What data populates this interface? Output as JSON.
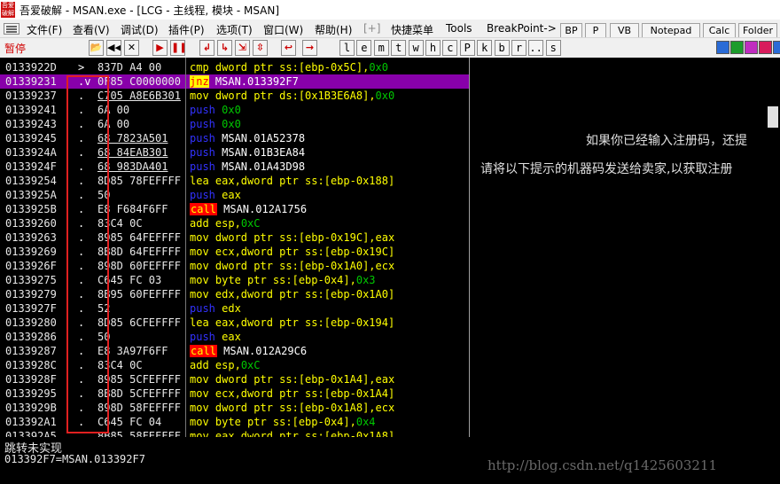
{
  "window": {
    "title": "吾爱破解 - MSAN.exe - [LCG - 主线程, 模块 - MSAN]",
    "app_icon_text": "吾爱破解"
  },
  "menubar": {
    "items": [
      "文件(F)",
      "查看(V)",
      "调试(D)",
      "插件(P)",
      "选项(T)",
      "窗口(W)",
      "帮助(H)",
      "[+]",
      "快捷菜单",
      "Tools",
      "BreakPoint->"
    ]
  },
  "right_panel_buttons": [
    "BP",
    "P",
    "VB",
    "Notepad",
    "Calc",
    "Folder"
  ],
  "toolbar": {
    "status": "暂停",
    "nav_buttons": [
      {
        "name": "open-file-button",
        "glyph": "📂",
        "red": false
      },
      {
        "name": "restart-button",
        "glyph": "◀◀",
        "red": false
      },
      {
        "name": "close-process-button",
        "glyph": "✕",
        "red": false
      },
      {
        "name": "run-button",
        "glyph": "▶",
        "red": true
      },
      {
        "name": "pause-button",
        "glyph": "❚❚",
        "red": true
      },
      {
        "name": "step-into-button",
        "glyph": "↲",
        "red": true
      },
      {
        "name": "step-over-button",
        "glyph": "↳",
        "red": true
      },
      {
        "name": "trace-into-button",
        "glyph": "⇲",
        "red": true
      },
      {
        "name": "trace-over-button",
        "glyph": "⇳",
        "red": true
      },
      {
        "name": "execute-till-return-button",
        "glyph": "↩",
        "red": true
      },
      {
        "name": "go-to-address-button",
        "glyph": "→",
        "red": true
      }
    ],
    "window_letters": [
      "l",
      "e",
      "m",
      "t",
      "w",
      "h",
      "c",
      "P",
      "k",
      "b",
      "r",
      "...",
      "s"
    ],
    "right_icons": [
      {
        "name": "refresh-icon",
        "color": "#2a6bd6"
      },
      {
        "name": "grid-green-icon",
        "color": "#1c9c2c"
      },
      {
        "name": "sparkle-icon",
        "color": "#c02cc0"
      },
      {
        "name": "about-a-icon",
        "color": "#d81c5c"
      },
      {
        "name": "options-grid-icon",
        "color": "#2a6bd6"
      }
    ]
  },
  "disassembly": {
    "rows": [
      {
        "addr": "0133922D",
        "mark": ">",
        "hex": "837D A4 00",
        "hex_ul": false,
        "selected": false,
        "asm": [
          {
            "t": "cmp",
            "k": "mn"
          },
          {
            "t": " dword ptr ss:[ebp-0x5C]",
            "k": "op y"
          },
          {
            "t": ",",
            "k": "op y"
          },
          {
            "t": "0x0",
            "k": "op imm"
          }
        ]
      },
      {
        "addr": "01339231",
        "mark": ".v",
        "hex": "0F85 C0000000",
        "hex_ul": false,
        "selected": true,
        "asm": [
          {
            "t": "jnz",
            "k": "mn jnz"
          },
          {
            "t": " MSAN.013392F7",
            "k": "op"
          }
        ]
      },
      {
        "addr": "01339237",
        "mark": ".",
        "hex": "C705 A8E6B301",
        "hex_ul": true,
        "selected": false,
        "asm": [
          {
            "t": "mov",
            "k": "mn"
          },
          {
            "t": " dword ptr ds:[0x1B3E6A8]",
            "k": "op y"
          },
          {
            "t": ",",
            "k": "op y"
          },
          {
            "t": "0x0",
            "k": "op imm"
          }
        ]
      },
      {
        "addr": "01339241",
        "mark": ".",
        "hex": "6A 00",
        "hex_ul": false,
        "selected": false,
        "asm": [
          {
            "t": "push",
            "k": "mn push"
          },
          {
            "t": " 0x0",
            "k": "op imm"
          }
        ]
      },
      {
        "addr": "01339243",
        "mark": ".",
        "hex": "6A 00",
        "hex_ul": false,
        "selected": false,
        "asm": [
          {
            "t": "push",
            "k": "mn push"
          },
          {
            "t": " 0x0",
            "k": "op imm"
          }
        ]
      },
      {
        "addr": "01339245",
        "mark": ".",
        "hex": "68 7823A501",
        "hex_ul": true,
        "selected": false,
        "asm": [
          {
            "t": "push",
            "k": "mn push"
          },
          {
            "t": " MSAN.01A52378",
            "k": "op"
          }
        ]
      },
      {
        "addr": "0133924A",
        "mark": ".",
        "hex": "68 84EAB301",
        "hex_ul": true,
        "selected": false,
        "asm": [
          {
            "t": "push",
            "k": "mn push"
          },
          {
            "t": " MSAN.01B3EA84",
            "k": "op"
          }
        ]
      },
      {
        "addr": "0133924F",
        "mark": ".",
        "hex": "68 983DA401",
        "hex_ul": true,
        "selected": false,
        "asm": [
          {
            "t": "push",
            "k": "mn push"
          },
          {
            "t": " MSAN.01A43D98",
            "k": "op"
          }
        ]
      },
      {
        "addr": "01339254",
        "mark": ".",
        "hex": "8D85 78FEFFFF",
        "hex_ul": false,
        "selected": false,
        "asm": [
          {
            "t": "lea",
            "k": "mn"
          },
          {
            "t": " eax,dword ptr ss:[ebp-0x188]",
            "k": "op y"
          }
        ]
      },
      {
        "addr": "0133925A",
        "mark": ".",
        "hex": "50",
        "hex_ul": false,
        "selected": false,
        "asm": [
          {
            "t": "push",
            "k": "mn push"
          },
          {
            "t": " eax",
            "k": "op push-op"
          }
        ]
      },
      {
        "addr": "0133925B",
        "mark": ".",
        "hex": "E8 F684F6FF",
        "hex_ul": false,
        "selected": false,
        "asm": [
          {
            "t": "call",
            "k": "mn call"
          },
          {
            "t": " MSAN.012A1756",
            "k": "op"
          }
        ]
      },
      {
        "addr": "01339260",
        "mark": ".",
        "hex": "83C4 0C",
        "hex_ul": false,
        "selected": false,
        "asm": [
          {
            "t": "add",
            "k": "mn"
          },
          {
            "t": " esp,",
            "k": "op y"
          },
          {
            "t": "0xC",
            "k": "op imm"
          }
        ]
      },
      {
        "addr": "01339263",
        "mark": ".",
        "hex": "8985 64FEFFFF",
        "hex_ul": false,
        "selected": false,
        "asm": [
          {
            "t": "mov",
            "k": "mn"
          },
          {
            "t": " dword ptr ss:[ebp-0x19C],eax",
            "k": "op y"
          }
        ]
      },
      {
        "addr": "01339269",
        "mark": ".",
        "hex": "8B8D 64FEFFFF",
        "hex_ul": false,
        "selected": false,
        "asm": [
          {
            "t": "mov",
            "k": "mn"
          },
          {
            "t": " ecx,dword ptr ss:[ebp-0x19C]",
            "k": "op y"
          }
        ]
      },
      {
        "addr": "0133926F",
        "mark": ".",
        "hex": "898D 60FEFFFF",
        "hex_ul": false,
        "selected": false,
        "asm": [
          {
            "t": "mov",
            "k": "mn"
          },
          {
            "t": " dword ptr ss:[ebp-0x1A0],ecx",
            "k": "op y"
          }
        ]
      },
      {
        "addr": "01339275",
        "mark": ".",
        "hex": "C645 FC 03",
        "hex_ul": false,
        "selected": false,
        "asm": [
          {
            "t": "mov",
            "k": "mn"
          },
          {
            "t": " byte ptr ss:[ebp-0x4],",
            "k": "op y"
          },
          {
            "t": "0x3",
            "k": "op imm"
          }
        ]
      },
      {
        "addr": "01339279",
        "mark": ".",
        "hex": "8B95 60FEFFFF",
        "hex_ul": false,
        "selected": false,
        "asm": [
          {
            "t": "mov",
            "k": "mn"
          },
          {
            "t": " edx,dword ptr ss:[ebp-0x1A0]",
            "k": "op y"
          }
        ]
      },
      {
        "addr": "0133927F",
        "mark": ".",
        "hex": "52",
        "hex_ul": false,
        "selected": false,
        "asm": [
          {
            "t": "push",
            "k": "mn push"
          },
          {
            "t": " edx",
            "k": "op push-op"
          }
        ]
      },
      {
        "addr": "01339280",
        "mark": ".",
        "hex": "8D85 6CFEFFFF",
        "hex_ul": false,
        "selected": false,
        "asm": [
          {
            "t": "lea",
            "k": "mn"
          },
          {
            "t": " eax,dword ptr ss:[ebp-0x194]",
            "k": "op y"
          }
        ]
      },
      {
        "addr": "01339286",
        "mark": ".",
        "hex": "50",
        "hex_ul": false,
        "selected": false,
        "asm": [
          {
            "t": "push",
            "k": "mn push"
          },
          {
            "t": " eax",
            "k": "op push-op"
          }
        ]
      },
      {
        "addr": "01339287",
        "mark": ".",
        "hex": "E8 3A97F6FF",
        "hex_ul": false,
        "selected": false,
        "asm": [
          {
            "t": "call",
            "k": "mn call"
          },
          {
            "t": " MSAN.012A29C6",
            "k": "op"
          }
        ]
      },
      {
        "addr": "0133928C",
        "mark": ".",
        "hex": "83C4 0C",
        "hex_ul": false,
        "selected": false,
        "asm": [
          {
            "t": "add",
            "k": "mn"
          },
          {
            "t": " esp,",
            "k": "op y"
          },
          {
            "t": "0xC",
            "k": "op imm"
          }
        ]
      },
      {
        "addr": "0133928F",
        "mark": ".",
        "hex": "8985 5CFEFFFF",
        "hex_ul": false,
        "selected": false,
        "asm": [
          {
            "t": "mov",
            "k": "mn"
          },
          {
            "t": " dword ptr ss:[ebp-0x1A4],eax",
            "k": "op y"
          }
        ]
      },
      {
        "addr": "01339295",
        "mark": ".",
        "hex": "8B8D 5CFEFFFF",
        "hex_ul": false,
        "selected": false,
        "asm": [
          {
            "t": "mov",
            "k": "mn"
          },
          {
            "t": " ecx,dword ptr ss:[ebp-0x1A4]",
            "k": "op y"
          }
        ]
      },
      {
        "addr": "0133929B",
        "mark": ".",
        "hex": "898D 58FEFFFF",
        "hex_ul": false,
        "selected": false,
        "asm": [
          {
            "t": "mov",
            "k": "mn"
          },
          {
            "t": " dword ptr ss:[ebp-0x1A8],ecx",
            "k": "op y"
          }
        ]
      },
      {
        "addr": "013392A1",
        "mark": ".",
        "hex": "C645 FC 04",
        "hex_ul": false,
        "selected": false,
        "asm": [
          {
            "t": "mov",
            "k": "mn"
          },
          {
            "t": " byte ptr ss:[ebp-0x4],",
            "k": "op y"
          },
          {
            "t": "0x4",
            "k": "op imm"
          }
        ]
      },
      {
        "addr": "013392A5",
        "mark": ".",
        "hex": "8B85 58FEFFFF",
        "hex_ul": false,
        "selected": false,
        "asm": [
          {
            "t": "mov",
            "k": "mn"
          },
          {
            "t": " eax,dword ptr ss:[ebp-0x1A8]",
            "k": "op y"
          }
        ]
      }
    ]
  },
  "dialog_text": {
    "line1": "如果你已经输入注册码，还提",
    "line2": "请将以下提示的机器码发送给卖家,以获取注册"
  },
  "info_pane": {
    "line1": "跳转未实现",
    "line2": "013392F7=MSAN.013392F7"
  },
  "watermark": "http://blog.csdn.net/q1425603211"
}
